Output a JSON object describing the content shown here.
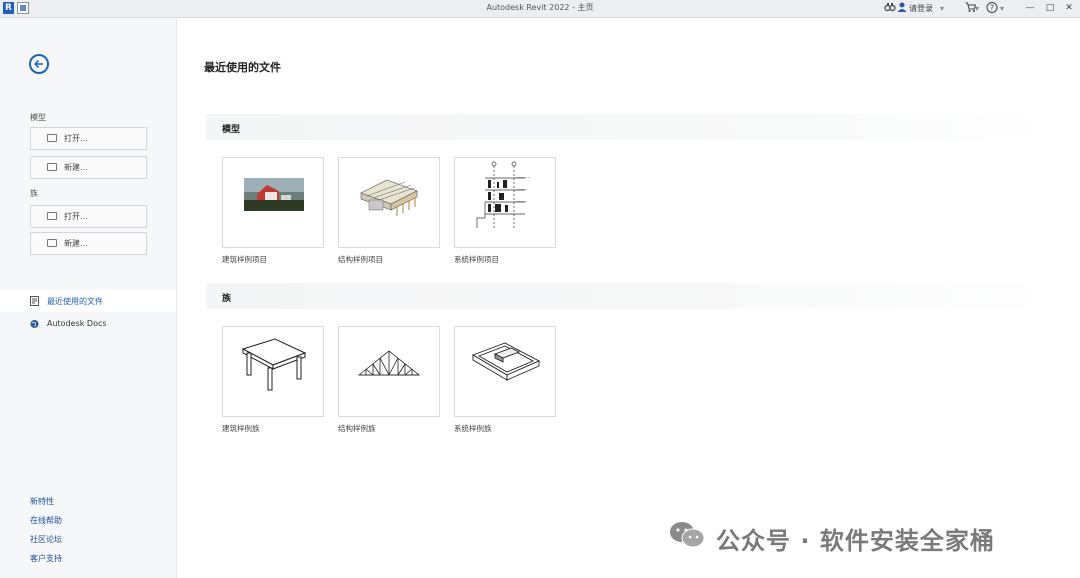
{
  "titlebar": {
    "app_logo": "R",
    "title": "Autodesk Revit 2022 - 主页",
    "user_label": "请登录",
    "icons": [
      "binoculars-icon",
      "user-icon",
      "cart-icon",
      "help-icon"
    ]
  },
  "window_controls": {
    "minimize": "—",
    "maximize": "□",
    "close": "✕"
  },
  "sidebar": {
    "model_section": "模型",
    "model_open": "打开...",
    "model_new": "新建...",
    "family_section": "族",
    "family_open": "打开...",
    "family_new": "新建...",
    "nav": [
      {
        "label": "最近使用的文件",
        "icon": "recent-files-icon",
        "active": true
      },
      {
        "label": "Autodesk Docs",
        "icon": "globe-icon",
        "active": false
      }
    ],
    "footer_links": [
      "新特性",
      "在线帮助",
      "社区论坛",
      "客户支持"
    ]
  },
  "main": {
    "title": "最近使用的文件",
    "groups": [
      {
        "label": "模型",
        "cards": [
          {
            "label": "建筑样例项目",
            "thumb": "architecture-project-thumbnail"
          },
          {
            "label": "结构样例项目",
            "thumb": "structure-project-thumbnail"
          },
          {
            "label": "系统样例项目",
            "thumb": "systems-project-thumbnail"
          }
        ]
      },
      {
        "label": "族",
        "cards": [
          {
            "label": "建筑样例族",
            "thumb": "table-family-thumbnail"
          },
          {
            "label": "结构样例族",
            "thumb": "truss-family-thumbnail"
          },
          {
            "label": "系统样例族",
            "thumb": "tray-family-thumbnail"
          }
        ]
      }
    ]
  },
  "watermark": {
    "text": "公众号 · 软件安装全家桶"
  },
  "colors": {
    "accent": "#1b64b8",
    "sidebar_bg": "#f6f7f8",
    "titlebar_bg": "#eceef1"
  }
}
